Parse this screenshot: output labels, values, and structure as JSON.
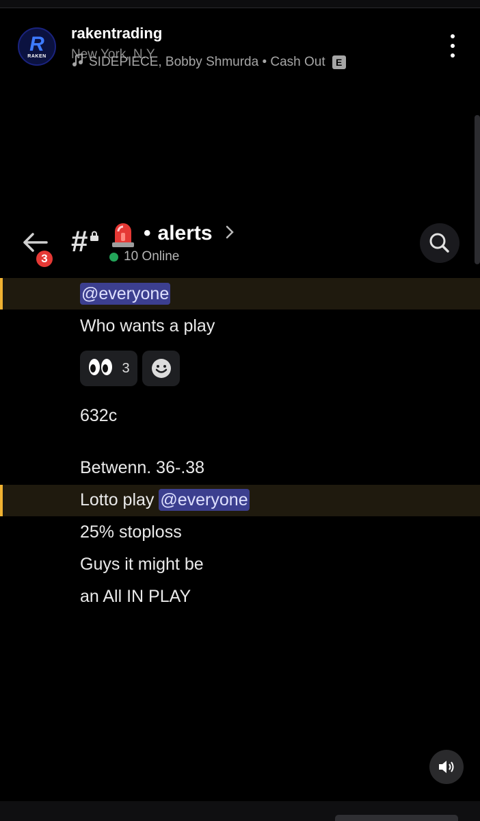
{
  "post_header": {
    "username": "rakentrading",
    "location": "New York, N.Y",
    "song": "SIDEPIECE, Bobby Shmurda • Cash Out",
    "explicit_badge": "E",
    "avatar_letter": "R",
    "avatar_text": "RAKEN"
  },
  "channel": {
    "unread_count": "3",
    "hash_symbol": "#",
    "separator": "•",
    "name": "alerts",
    "online_text": "10 Online"
  },
  "messages": {
    "mention_1": "@everyone",
    "line_1": "Who wants a play",
    "reaction_count": "3",
    "line_2": "632c",
    "line_3": "Betwenn. 36-.38",
    "line_4_prefix": "Lotto play",
    "mention_2": "@everyone",
    "line_5": "25% stoploss",
    "line_6": "Guys it might be",
    "line_7": "an All IN PLAY"
  },
  "colors": {
    "mention_bg": "#3c3f8f",
    "highlight_bar": "#f0b232",
    "online_dot": "#23a55a",
    "badge_red": "#e53935"
  }
}
